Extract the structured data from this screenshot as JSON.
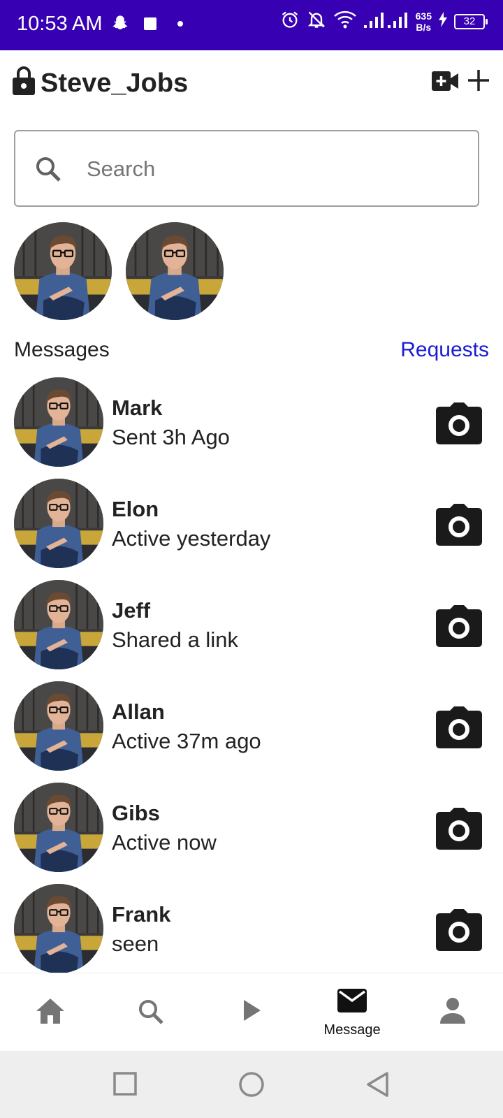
{
  "status_bar": {
    "time": "10:53 AM",
    "net_speed_value": "635",
    "net_speed_unit": "B/s",
    "battery": "32",
    "icons": [
      "snapchat-icon",
      "square-icon",
      "dot-icon",
      "alarm-icon",
      "bell-off-icon",
      "wifi-icon",
      "signal-icon",
      "charging-icon"
    ]
  },
  "header": {
    "username": "Steve_Jobs",
    "icons": [
      "lock-icon",
      "video-add-icon",
      "plus-icon"
    ]
  },
  "search": {
    "placeholder": "Search",
    "value": ""
  },
  "stories": {
    "count": 2
  },
  "messages_section": {
    "title": "Messages",
    "requests_label": "Requests"
  },
  "conversations": [
    {
      "name": "Mark",
      "status": "Sent 3h Ago"
    },
    {
      "name": "Elon",
      "status": "Active yesterday"
    },
    {
      "name": "Jeff",
      "status": "Shared a link"
    },
    {
      "name": "Allan",
      "status": "Active 37m ago"
    },
    {
      "name": "Gibs",
      "status": "Active now"
    },
    {
      "name": "Frank",
      "status": "seen"
    }
  ],
  "bottom_nav": {
    "items": [
      {
        "icon": "home-icon",
        "label": "",
        "active": false
      },
      {
        "icon": "search-icon",
        "label": "",
        "active": false
      },
      {
        "icon": "play-icon",
        "label": "",
        "active": false
      },
      {
        "icon": "mail-icon",
        "label": "Message",
        "active": true
      },
      {
        "icon": "person-icon",
        "label": "",
        "active": false
      }
    ]
  },
  "system_nav": {
    "icons": [
      "recents-icon",
      "home-circle-icon",
      "back-icon"
    ]
  },
  "colors": {
    "status_bar": "#3700b3",
    "requests_link": "#1a1ad6",
    "text": "#222222",
    "system_nav_bg": "#eeeeee"
  }
}
